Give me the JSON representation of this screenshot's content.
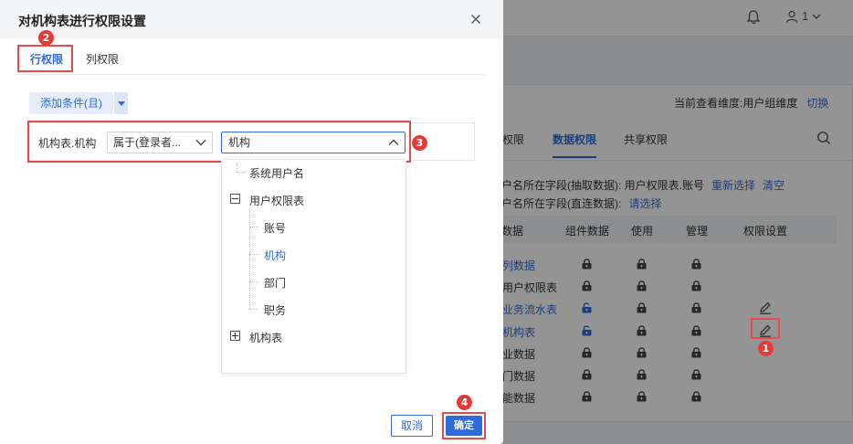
{
  "dialog": {
    "title": "对机构表进行权限设置",
    "tabs": [
      {
        "label": "行权限"
      },
      {
        "label": "列权限"
      }
    ],
    "add_condition": "添加条件(且)",
    "condition": {
      "field": "机构表.机构",
      "operator": "属于(登录者...",
      "value": "机构"
    },
    "tree": [
      {
        "label": "系统用户名"
      },
      {
        "label": "用户权限表"
      },
      {
        "label": "账号"
      },
      {
        "label": "机构"
      },
      {
        "label": "部门"
      },
      {
        "label": "职务"
      },
      {
        "label": "机构表"
      }
    ],
    "cancel": "取消",
    "ok": "确定"
  },
  "background": {
    "user": "1",
    "dimension": "当前查看维度:用户组维度",
    "switch": "切换",
    "subtabs": [
      "权限",
      "数据权限",
      "共享权限"
    ],
    "line1": "户名所在字段(抽取数据): 用户权限表.账号",
    "line1_links": [
      "重新选择",
      "清空"
    ],
    "line2": "户名所在字段(直连数据):",
    "line2_link": "请选择",
    "headers": [
      "数据",
      "组件数据",
      "使用",
      "管理",
      "权限设置"
    ],
    "rows": [
      {
        "name": "列数据",
        "link": true
      },
      {
        "name": "用户权限表",
        "link": false
      },
      {
        "name": "业务流水表",
        "link": true
      },
      {
        "name": "机构表",
        "link": true
      },
      {
        "name": "业数据",
        "link": false
      },
      {
        "name": "门数据",
        "link": false
      },
      {
        "name": "能数据",
        "link": false
      }
    ]
  },
  "badges": [
    "1",
    "2",
    "3",
    "4"
  ]
}
